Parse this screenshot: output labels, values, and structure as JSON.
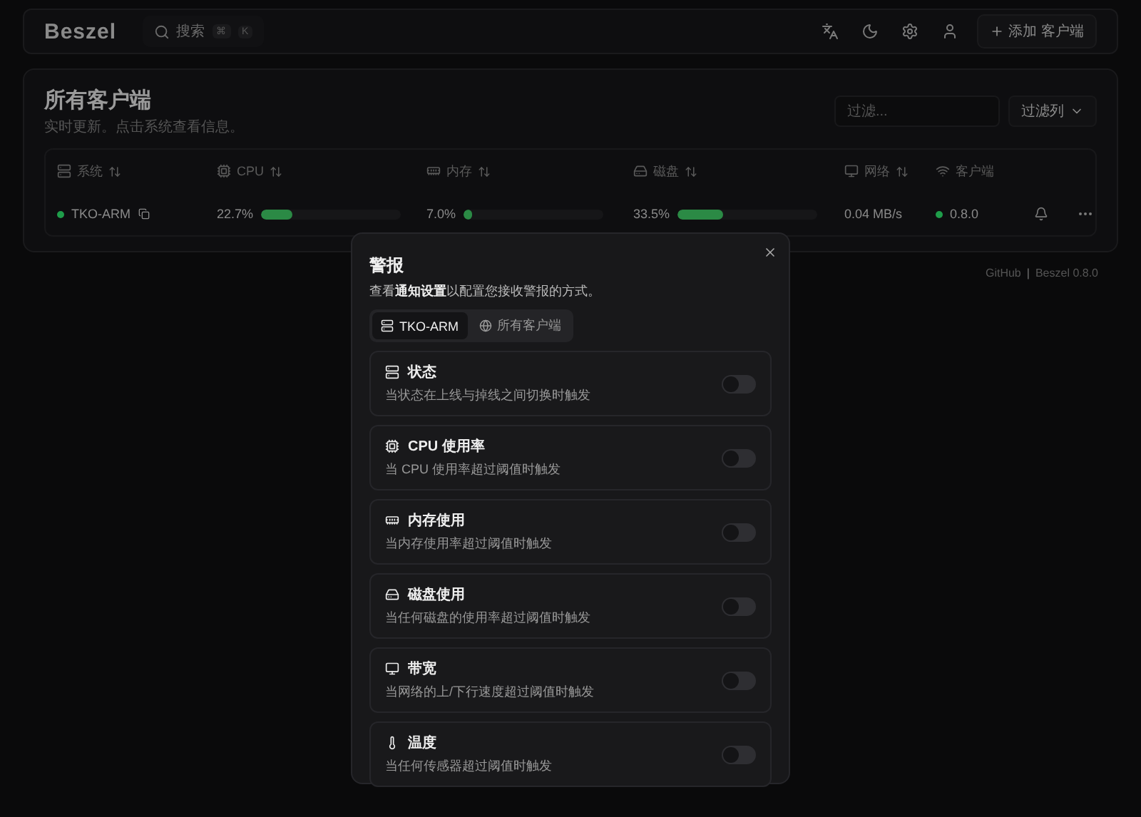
{
  "header": {
    "logo": "Beszel",
    "search": {
      "placeholder": "搜索",
      "shortcut": [
        "⌘",
        "K"
      ]
    },
    "add_button": "添加 客户端"
  },
  "panel": {
    "title": "所有客户端",
    "subtitle": "实时更新。点击系统查看信息。",
    "filter": {
      "placeholder": "过滤..."
    },
    "columns_button": "过滤列",
    "table": {
      "columns": [
        "系统",
        "CPU",
        "内存",
        "磁盘",
        "网络",
        "客户端"
      ],
      "rows": [
        {
          "name": "TKO-ARM",
          "status": {
            "color": "#1f9d4a"
          },
          "cpu": "22.7%",
          "cpu_level": {
            "level": 0.227
          },
          "memory": "7.0%",
          "memory_level": {
            "level": 0.07
          },
          "disk": "33.5%",
          "disk_level": {
            "level": 0.335
          },
          "network": "0.04 MB/s",
          "agent": {
            "color": "#1f9d4a",
            "version": "0.8.0"
          }
        }
      ]
    }
  },
  "footer": {
    "link": "GitHub",
    "separator": "|",
    "version": "Beszel 0.8.0"
  },
  "dialog": {
    "title": "警报",
    "description": {
      "before": "查看",
      "link": "通知设置",
      "after": "以配置您接收警报的方式。"
    },
    "tabs": [
      {
        "label": "TKO-ARM",
        "selected": true
      },
      {
        "label": "所有客户端",
        "selected": false
      }
    ],
    "alerts": [
      {
        "kind": "status",
        "title": "状态",
        "description": "当状态在上线与掉线之间切换时触发",
        "on": false
      },
      {
        "kind": "cpu",
        "title": "CPU 使用率",
        "description": "当 CPU 使用率超过阈值时触发",
        "on": false
      },
      {
        "kind": "memory",
        "title": "内存使用",
        "description": "当内存使用率超过阈值时触发",
        "on": false
      },
      {
        "kind": "disk",
        "title": "磁盘使用",
        "description": "当任何磁盘的使用率超过阈值时触发",
        "on": false
      },
      {
        "kind": "bandwidth",
        "title": "带宽",
        "description": "当网络的上/下行速度超过阈值时触发",
        "on": false
      },
      {
        "kind": "temperature",
        "title": "温度",
        "description": "当任何传感器超过阈值时触发",
        "on": false
      }
    ]
  }
}
